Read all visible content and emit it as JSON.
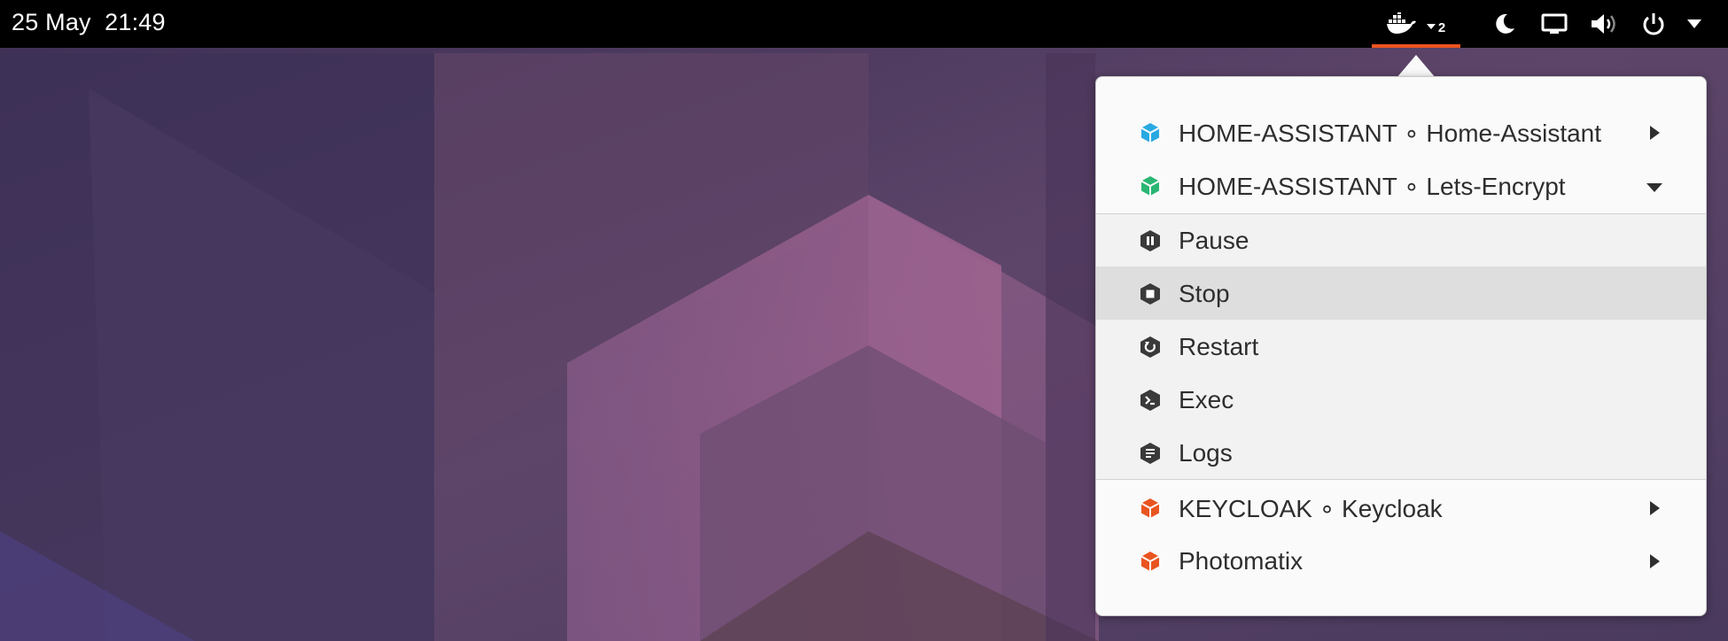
{
  "topbar": {
    "date": "25 May",
    "time": "21:49",
    "docker_indicator": {
      "icon": "docker-whale-icon",
      "count": "2"
    },
    "tray_icons": [
      "night-light-icon",
      "screen-icon",
      "volume-icon",
      "power-icon",
      "system-menu-arrow-icon"
    ]
  },
  "menu": {
    "containers": [
      {
        "label": "HOME-ASSISTANT ∘ Home-Assistant",
        "icon": "container-cube-icon",
        "color": "#29a9e1",
        "state": "collapsed"
      },
      {
        "label": "HOME-ASSISTANT ∘ Lets-Encrypt",
        "icon": "container-cube-icon",
        "color": "#2bb673",
        "state": "expanded"
      }
    ],
    "actions": [
      {
        "label": "Pause",
        "icon": "pause-icon"
      },
      {
        "label": "Stop",
        "icon": "stop-icon"
      },
      {
        "label": "Restart",
        "icon": "restart-icon"
      },
      {
        "label": "Exec",
        "icon": "terminal-icon"
      },
      {
        "label": "Logs",
        "icon": "logs-icon"
      }
    ],
    "more_containers": [
      {
        "label": "KEYCLOAK ∘ Keycloak",
        "icon": "container-cube-icon",
        "color": "#e95420",
        "state": "collapsed"
      },
      {
        "label": "Photomatix",
        "icon": "container-cube-icon",
        "color": "#e95420",
        "state": "collapsed"
      }
    ]
  },
  "colors": {
    "accent": "#e95420",
    "topbar": "#000000",
    "menu_bg": "#fafafa",
    "hover_bg": "#dedede"
  }
}
